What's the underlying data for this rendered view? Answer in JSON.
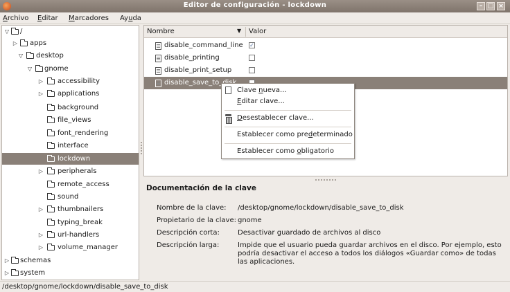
{
  "window": {
    "title": "Editor de configuración - lockdown"
  },
  "menu": [
    {
      "pre": "",
      "acc": "A",
      "post": "rchivo"
    },
    {
      "pre": "",
      "acc": "E",
      "post": "ditar"
    },
    {
      "pre": "",
      "acc": "M",
      "post": "arcadores"
    },
    {
      "pre": "Ay",
      "acc": "u",
      "post": "da"
    }
  ],
  "tree": [
    {
      "label": "/",
      "twisty": "▽"
    },
    {
      "label": "apps",
      "twisty": "▷"
    },
    {
      "label": "desktop",
      "twisty": "▽"
    },
    {
      "label": "gnome",
      "twisty": "▽"
    },
    {
      "label": "accessibility",
      "twisty": "▷"
    },
    {
      "label": "applications",
      "twisty": "▷"
    },
    {
      "label": "background",
      "twisty": ""
    },
    {
      "label": "file_views",
      "twisty": ""
    },
    {
      "label": "font_rendering",
      "twisty": ""
    },
    {
      "label": "interface",
      "twisty": ""
    },
    {
      "label": "lockdown",
      "twisty": "",
      "selected": true
    },
    {
      "label": "peripherals",
      "twisty": "▷"
    },
    {
      "label": "remote_access",
      "twisty": ""
    },
    {
      "label": "sound",
      "twisty": ""
    },
    {
      "label": "thumbnailers",
      "twisty": "▷"
    },
    {
      "label": "typing_break",
      "twisty": ""
    },
    {
      "label": "url-handlers",
      "twisty": "▷"
    },
    {
      "label": "volume_manager",
      "twisty": "▷"
    },
    {
      "label": "schemas",
      "twisty": "▷"
    },
    {
      "label": "system",
      "twisty": "▷"
    }
  ],
  "list": {
    "col_name": "Nombre",
    "col_value": "Valor",
    "sort_glyph": "▼",
    "rows": [
      {
        "name": "disable_command_line",
        "checked": true
      },
      {
        "name": "disable_printing",
        "checked": false
      },
      {
        "name": "disable_print_setup",
        "checked": false
      },
      {
        "name": "disable_save_to_disk",
        "checked": false,
        "selected": true
      }
    ]
  },
  "context_menu": {
    "new_key": {
      "pre": "Clave ",
      "acc": "n",
      "post": "ueva..."
    },
    "edit_key": {
      "pre": "",
      "acc": "E",
      "post": "ditar clave..."
    },
    "unset_key": {
      "pre": "",
      "acc": "D",
      "post": "esestablecer clave..."
    },
    "set_default": {
      "pre": "Establecer como pre",
      "acc": "d",
      "post": "eterminado"
    },
    "set_mandatory": {
      "pre": "Establecer como ",
      "acc": "o",
      "post": "bligatorio"
    }
  },
  "documentation": {
    "heading": "Documentación de la clave",
    "key_name_label": "Nombre de la clave:",
    "key_name": "/desktop/gnome/lockdown/disable_save_to_disk",
    "owner_label": "Propietario de la clave:",
    "owner": "gnome",
    "short_desc_label": "Descripción corta:",
    "short_desc": "Desactivar guardado de archivos al disco",
    "long_desc_label": "Descripción larga:",
    "long_desc": "Impide que el usuario pueda guardar archivos en el disco. Por ejemplo, esto podría desactivar el acceso a todos los diálogos «Guardar como» de todas las aplicaciones."
  },
  "status": {
    "path": "/desktop/gnome/lockdown/disable_save_to_disk"
  }
}
